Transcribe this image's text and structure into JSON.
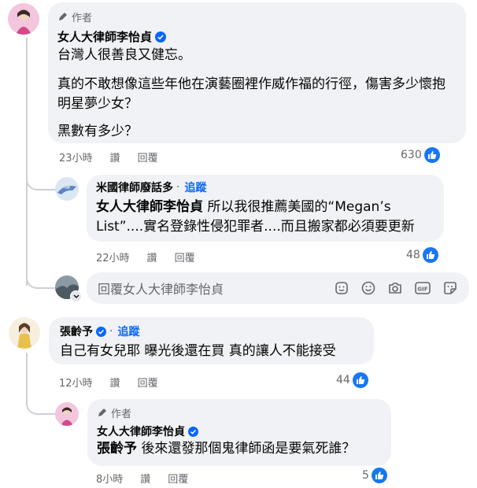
{
  "comments": [
    {
      "author_badge": "作者",
      "name": "女人大律師李怡貞",
      "verified": true,
      "paragraphs": [
        "台灣人很善良又健忘。",
        "真的不敢想像這些年他在演藝圈裡作威作福的行徑，傷害多少懷抱明星夢少女？",
        "黑數有多少？"
      ],
      "time": "23小時",
      "read": "讚",
      "reply": "回覆",
      "likes": "630"
    },
    {
      "name": "米國律師廢話多",
      "follow": "追蹤",
      "tag": "女人大律師李怡貞",
      "text_line1": "所以我很推薦美國的“Megan’s",
      "text_line2": "List”....實名登錄性侵犯罪者....而且搬家都必須要更新",
      "time": "22小時",
      "read": "讚",
      "reply": "回覆",
      "likes": "48"
    },
    {
      "name": "張齡予",
      "follow": "追蹤",
      "verified": true,
      "text": "自己有女兒耶 曝光後還在買 真的讓人不能接受",
      "time": "12小時",
      "read": "讚",
      "reply": "回覆",
      "likes": "44"
    },
    {
      "author_badge": "作者",
      "name": "女人大律師李怡貞",
      "verified": true,
      "tag": "張齡予",
      "text": "後來還發那個鬼律師函是要氣死誰？",
      "time": "8小時",
      "read": "讚",
      "reply": "回覆",
      "likes": "5"
    }
  ],
  "reply_box": {
    "placeholder": "回覆女人大律師李怡貞",
    "icons": [
      "sticker-face-icon",
      "emoji-icon",
      "camera-icon",
      "gif-icon",
      "sticker-icon"
    ]
  },
  "colors": {
    "accent": "#0866ff",
    "like": "#1877f2",
    "bubble": "#f0f2f5",
    "muted": "#65676b"
  }
}
